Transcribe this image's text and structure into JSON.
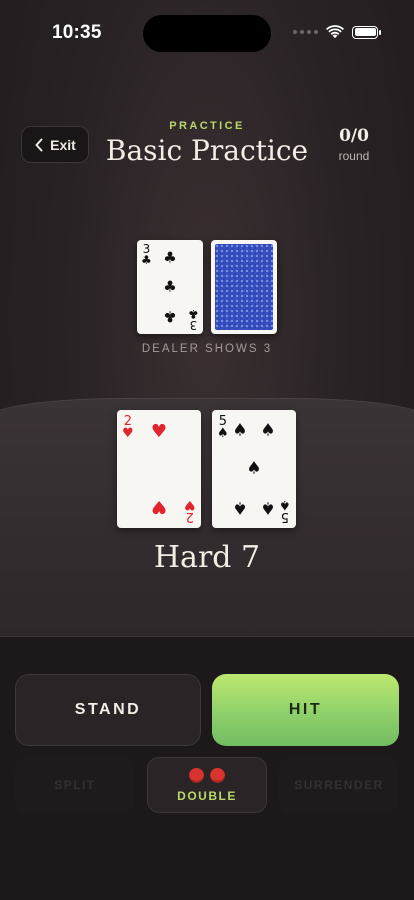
{
  "status_bar": {
    "time": "10:35"
  },
  "header": {
    "exit_label": "Exit",
    "mode_label": "PRACTICE",
    "title": "Basic Practice",
    "score_value": "0/0",
    "score_label": "round"
  },
  "dealer": {
    "caption": "DEALER SHOWS 3",
    "upcard": {
      "rank": "3",
      "suit": "♣",
      "color": "#111111"
    },
    "hole_card": "face-down"
  },
  "player": {
    "cards": [
      {
        "rank": "2",
        "suit": "♥",
        "color": "#e2242f"
      },
      {
        "rank": "5",
        "suit": "♠",
        "color": "#111111"
      }
    ],
    "hand_total": "Hard 7"
  },
  "actions": {
    "stand": "STAND",
    "hit": "HIT",
    "split": "SPLIT",
    "double": "DOUBLE",
    "surrender": "SURRENDER"
  },
  "colors": {
    "accent_green": "#b8d86a",
    "hit_gradient_top": "#bde870",
    "hit_gradient_bottom": "#72bd63",
    "chip_red": "#d9332f",
    "card_back_blue": "#2f47b5"
  }
}
